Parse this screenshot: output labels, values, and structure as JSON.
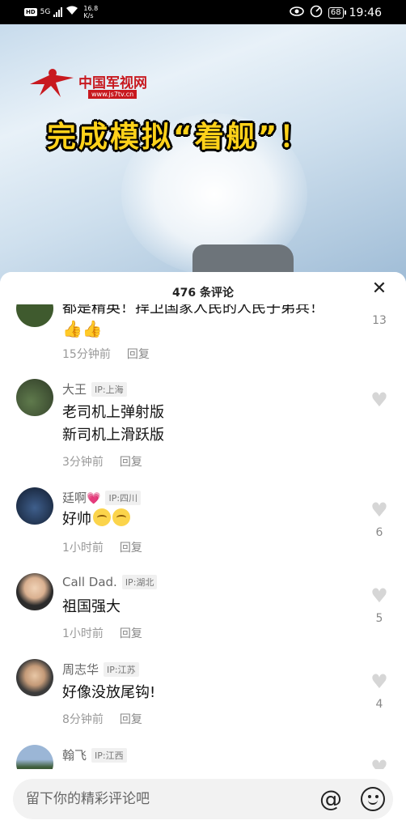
{
  "status_bar": {
    "hd_badge": "HD",
    "network": "5G",
    "speed_value": "16.8",
    "speed_unit": "K/s",
    "battery": "68",
    "time": "19:46"
  },
  "video": {
    "logo_name": "中国军视网",
    "logo_url": "www.js7tv.cn",
    "caption": "完成模拟“着舰”！"
  },
  "comments_panel": {
    "title": "476 条评论",
    "close_icon": "close-icon",
    "comments": [
      {
        "name": "",
        "ip": "",
        "text": "都是精英！捍卫国家人民的人民子弟兵！",
        "time": "15分钟前",
        "reply": "回复",
        "likes": "13"
      },
      {
        "name": "大王",
        "ip": "IP:上海",
        "text_line1": "老司机上弹射版",
        "text_line2": "新司机上滑跃版",
        "time": "3分钟前",
        "reply": "回复",
        "likes": ""
      },
      {
        "name": "廷啊",
        "ip": "IP:四川",
        "text": "好帅",
        "time": "1小时前",
        "reply": "回复",
        "likes": "6"
      },
      {
        "name": "Call Dad.",
        "ip": "IP:湖北",
        "text": "祖国强大",
        "time": "1小时前",
        "reply": "回复",
        "likes": "5"
      },
      {
        "name": "周志华",
        "ip": "IP:江苏",
        "text": "好像没放尾钩!",
        "time": "8分钟前",
        "reply": "回复",
        "likes": "4"
      },
      {
        "name": "翰飞",
        "ip": "IP:江西",
        "text": "",
        "time": "",
        "reply": "",
        "likes": ""
      }
    ]
  },
  "input_bar": {
    "placeholder": "留下你的精彩评论吧",
    "at_symbol": "@",
    "icons": [
      "at-icon",
      "emoji-icon"
    ]
  },
  "colors": {
    "caption_yellow": "#ffd21a",
    "logo_red": "#c8191f",
    "heart_grey": "#d6d6d6"
  }
}
